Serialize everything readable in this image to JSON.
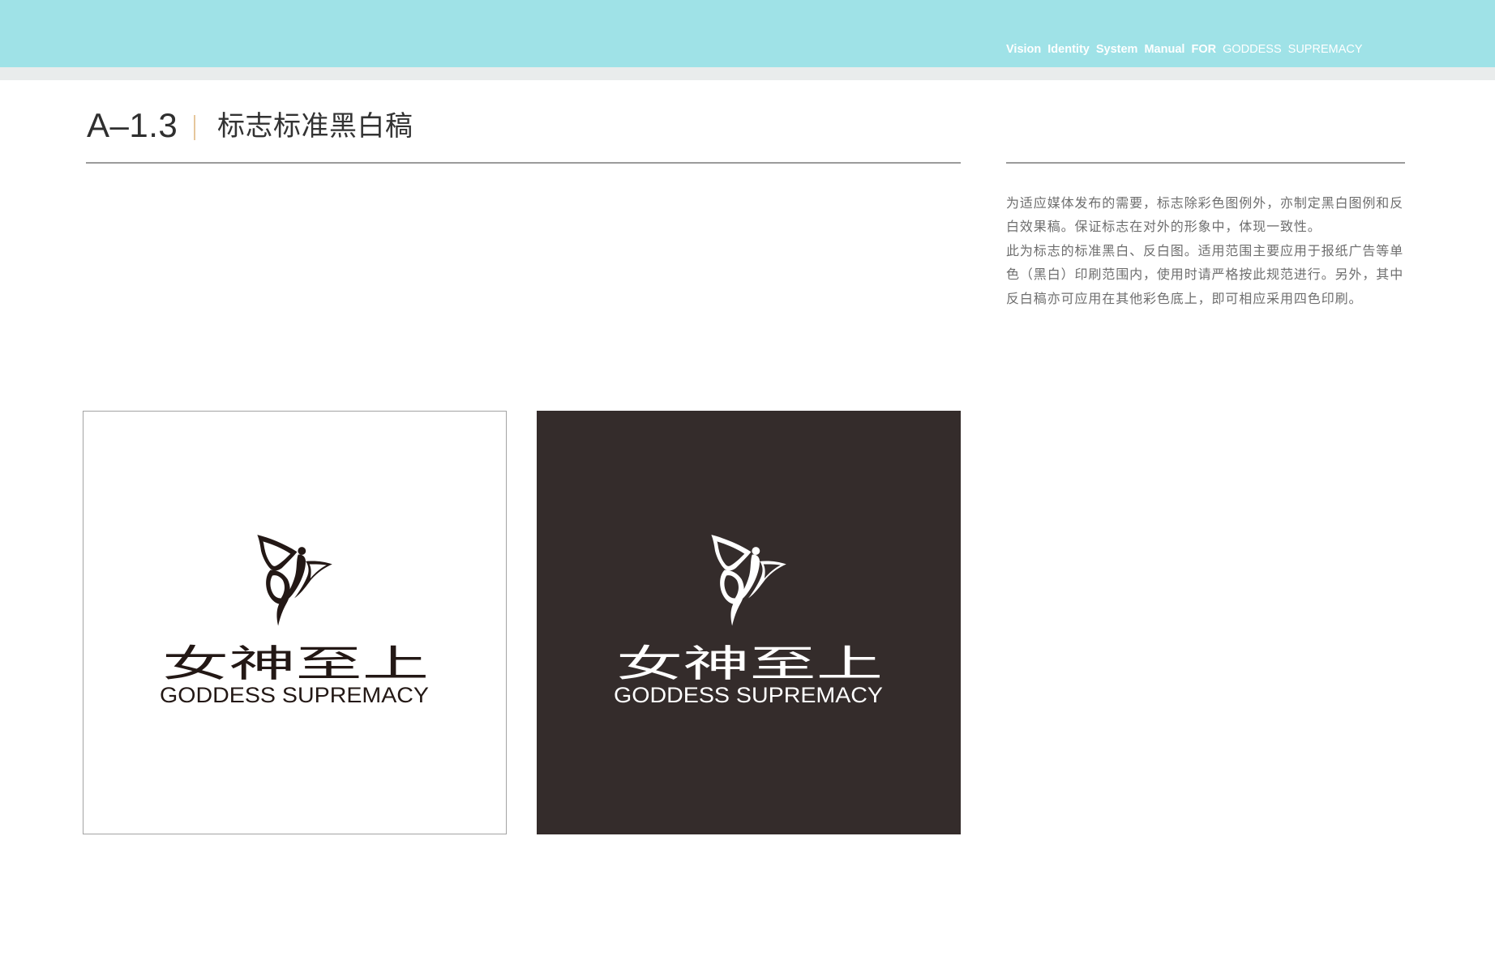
{
  "header": {
    "manual_title": "Vision Identity System Manual",
    "for_label": "FOR",
    "brand": "GODDESS SUPREMACY"
  },
  "section": {
    "code": "A–1.3",
    "title": "标志标准黑白稿"
  },
  "description": {
    "lines": [
      "为适应媒体发布的需要，标志除彩色图例外，亦制定黑白图例和反",
      "白效果稿。保证标志在对外的形象中，体现一致性。",
      "此为标志的标准黑白、反白图。适用范围主要应用于报纸广告等单",
      "色（黑白）印刷范围内，使用时请严格按此规范进行。另外，其中",
      "反白稿亦可应用在其他彩色底上，即可相应采用四色印刷。"
    ]
  },
  "logo": {
    "icon": "butterfly-icon",
    "chinese_name": "女神至上",
    "english_name": "GODDESS SUPREMACY"
  },
  "variants": [
    {
      "background": "#ffffff",
      "foreground": "#231815"
    },
    {
      "background": "#342c2b",
      "foreground": "#ffffff"
    }
  ],
  "colors": {
    "header_band": "#9fe2e7",
    "header_strip": "#e9ecec",
    "title_separator": "#e6c79c",
    "rule": "#9b9b9b",
    "body_text": "#6e6e6e"
  }
}
